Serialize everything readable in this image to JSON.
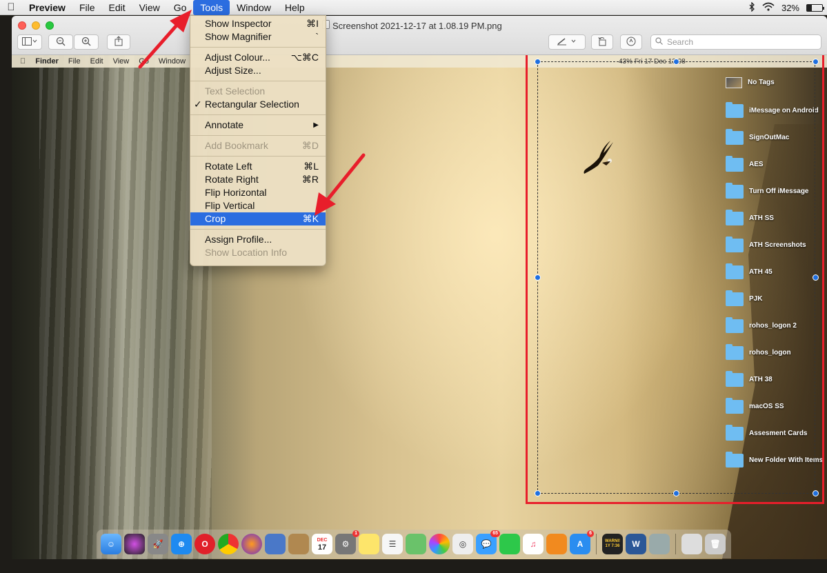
{
  "menubar": {
    "app": "Preview",
    "items": [
      "File",
      "Edit",
      "View",
      "Go",
      "Tools",
      "Window",
      "Help"
    ],
    "battery": "32%",
    "battery_fraction": 0.32
  },
  "window": {
    "title": "Screenshot 2021-12-17 at 1.08.19 PM.png",
    "search_placeholder": "Search"
  },
  "tools_menu": {
    "show_inspector": "Show Inspector",
    "show_inspector_sc": "⌘I",
    "show_magnifier": "Show Magnifier",
    "show_magnifier_sc": "`",
    "adjust_colour": "Adjust Colour...",
    "adjust_colour_sc": "⌥⌘C",
    "adjust_size": "Adjust Size...",
    "text_selection": "Text Selection",
    "rect_selection": "Rectangular Selection",
    "checkmark": "✓",
    "annotate": "Annotate",
    "submenu_arrow": "▶",
    "add_bookmark": "Add Bookmark",
    "add_bookmark_sc": "⌘D",
    "rotate_left": "Rotate Left",
    "rotate_left_sc": "⌘L",
    "rotate_right": "Rotate Right",
    "rotate_right_sc": "⌘R",
    "flip_horizontal": "Flip Horizontal",
    "flip_vertical": "Flip Vertical",
    "crop": "Crop",
    "crop_sc": "⌘K",
    "assign_profile": "Assign Profile...",
    "show_location": "Show Location Info"
  },
  "screenshot": {
    "menubar": {
      "items": [
        "Finder",
        "File",
        "Edit",
        "View",
        "Go",
        "Window"
      ],
      "status": "43%  Fri 17 Dec  13:08"
    },
    "desktop_items": [
      "No Tags",
      "iMessage on Android",
      "SignOutMac",
      "AES",
      "Turn Off iMessage",
      "ATH SS",
      "ATH Screenshots",
      "ATH 45",
      "PJK",
      "rohos_logon 2",
      "rohos_logon",
      "ATH 38",
      "macOS SS",
      "Assesment Cards",
      "New Folder With Items"
    ],
    "dock": {
      "calendar_month": "DEC",
      "calendar_day": "17",
      "badge_settings": "1",
      "badge_messages": "65",
      "badge_appstore": "6",
      "warning_text": "WARNI! 1Y 7:36"
    }
  }
}
